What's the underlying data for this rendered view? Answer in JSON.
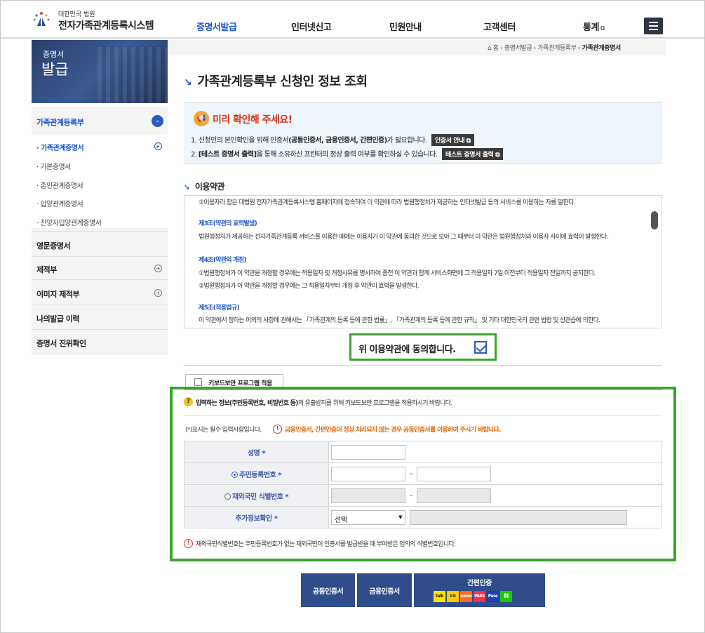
{
  "header": {
    "logo_sub": "대한민국 법원",
    "logo_main": "전자가족관계등록시스템",
    "nav": [
      "증명서발급",
      "인터넷신고",
      "민원안내",
      "고객센터",
      "통계"
    ],
    "nav_ext_icon": "external-link-icon"
  },
  "sidebar": {
    "banner_small": "증명서",
    "banner_big": "발급",
    "items": [
      "가족관계등록부",
      "영문증명서",
      "제적부",
      "이미지 제적부",
      "나의발급 이력",
      "증명서 진위확인"
    ],
    "sub_items": [
      "가족관계증명서",
      "기본증명서",
      "혼인관계증명서",
      "입양관계증명서",
      "친양자입양관계증명서"
    ]
  },
  "breadcrumb": {
    "home": "홈",
    "items": [
      "증명서발급",
      "가족관계등록부"
    ],
    "current": "가족관계증명서"
  },
  "page": {
    "title": "가족관계등록부 신청인 정보 조회"
  },
  "notice": {
    "title": "미리 확인해 주세요!",
    "line1_a": "1. 신청인의 본인확인을 위해 인증서",
    "line1_b": "(공동인증서, 금융인증서, 간편인증)",
    "line1_c": "가 필요합니다.",
    "line1_btn": "인증서 안내",
    "line2_a": "2. ",
    "line2_b": "[테스트 증명서 출력]",
    "line2_c": "을 통해 소유하신 프린터의 정상 출력 여부를 확인하실 수 있습니다.",
    "line2_btn": "테스트 증명서 출력"
  },
  "terms": {
    "section_title": "이용약관",
    "rows": [
      {
        "text": "②이용자라 함은 대법원 전자가족관계등록시스템 홈페이지에 접속하여 이 약관에 따라 법원행정처가 제공하는 인터넷발급 등의 서비스를 이용하는 자를 말한다.",
        "h": false
      },
      {
        "text": "제3조(약관의 효력발생)",
        "h": true
      },
      {
        "text": "법원행정처가 제공하는 전자가족관계등록 서비스를 이용한 때에는 이용자가 이 약관에 동의한 것으로 보아 그 때부터 이 약관은 법원행정처와 이용자 사이에 효력이 발생한다.",
        "h": false
      },
      {
        "text": "제4조(약관의 개정)",
        "h": true
      },
      {
        "text": "①법원행정처가 이 약관을 개정할 경우에는 적용일자 및 개정사유를 명시하여 종전 이 약관과 함께 서비스화면에 그 적용일자 7일 이전부터 적용일자 전일까지 공지한다.",
        "h": false
      },
      {
        "text": "②법원행정처가 이 약관을 개정할 경우에는 그 적용일자부터 개정 후 약관이 효력을 발생한다.",
        "h": false
      },
      {
        "text": "제5조(적용법규)",
        "h": true
      },
      {
        "text": "이 약관에서 정하는 이외의 사항에 관해서는 「가족관계의 등록 등에 관한 법률」, 「가족관계의 등록 등에 관한 규칙」 및 기타 대한민국의 관련 법령 및 상관습에 의한다.",
        "h": false
      }
    ],
    "agree_label": "위 이용약관에 동의합니다."
  },
  "form": {
    "keyboard_security": "키보드보안 프로그램 적용",
    "info_a": "입력하는 정보",
    "info_b": "(주민등록번호, 비밀번호 등)",
    "info_c": "의 유출방지를 위해 키보드보안 프로그램을 적용하시기 바랍니다.",
    "required_note_a": "(",
    "required_note_star": "*",
    "required_note_b": ")표시는 필수 입력사항입니다.",
    "warning": "금융인증서, 간편인증이 정상 처리되지 않는 경우 공동인증서를 이용하여 주시기 바랍니다.",
    "rows": {
      "name_label": "성명",
      "rrn_label": "주민등록번호",
      "foreign_label": "재외국민 식별번호",
      "extra_label": "추가정보확인"
    },
    "star": "*",
    "dash": "-",
    "select_value": "선택",
    "foot_note": "재외국민식별번호는 주민등록번호가 없는 재외국민이 인증서를 발급받을 때 부여받은 임의의 식별번호입니다."
  },
  "actions": {
    "public_cert": "공동인증서",
    "financial_cert": "금융인증서",
    "simple_auth": "간편인증",
    "simple_icons": [
      "talk",
      "KB",
      "naver",
      "PASS",
      "Pass",
      "N"
    ]
  },
  "colors": {
    "accent": "#1e56c8",
    "highlight_box": "#3ba52b",
    "button": "#2f4d8b",
    "warning": "#e06a10"
  }
}
